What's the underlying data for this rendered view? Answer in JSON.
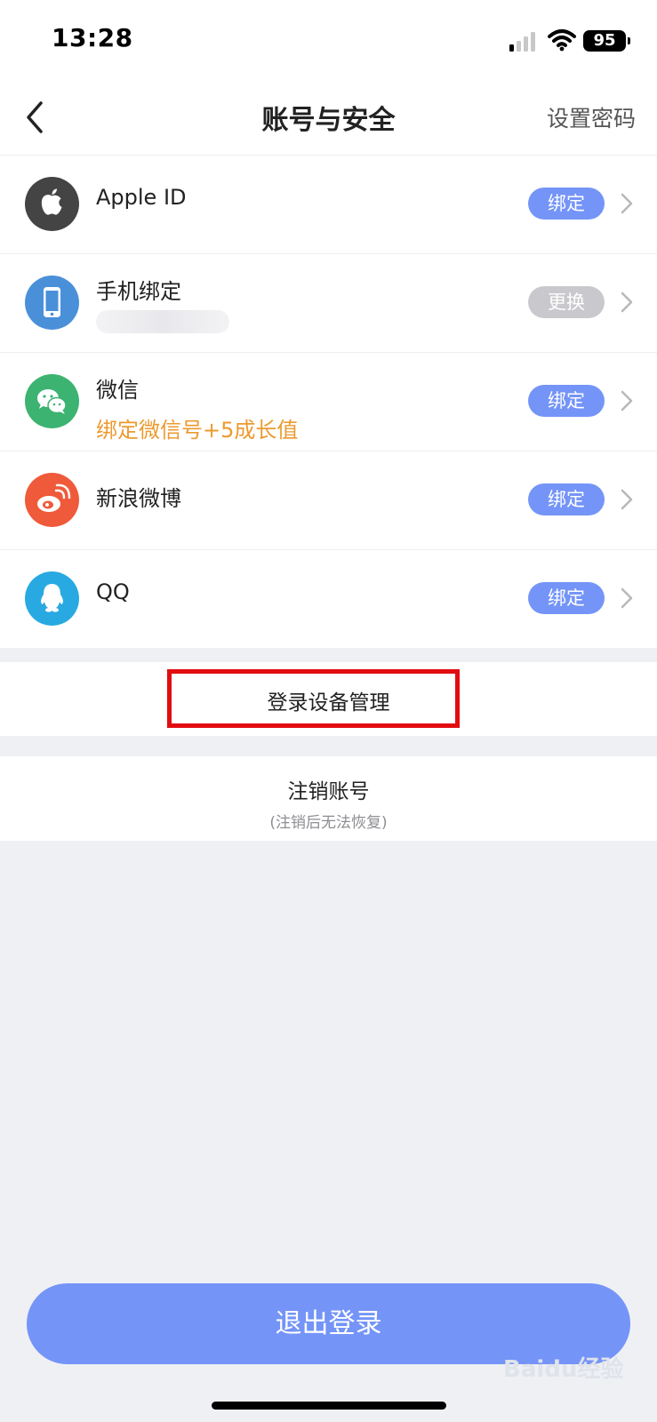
{
  "status_bar": {
    "time": "13:28",
    "battery": "95"
  },
  "header": {
    "title": "账号与安全",
    "right_action": "设置密码"
  },
  "accounts": [
    {
      "name": "Apple ID",
      "action": "绑定",
      "icon": "apple-icon",
      "icon_color": "#444444",
      "action_color": "#7494f7"
    },
    {
      "name": "手机绑定",
      "subtitle_hidden": true,
      "action": "更换",
      "icon": "phone-icon",
      "icon_color": "#4a90d9",
      "action_color": "#c9c9cd"
    },
    {
      "name": "微信",
      "subtitle": "绑定微信号+5成长值",
      "action": "绑定",
      "icon": "wechat-icon",
      "icon_color": "#3cb371",
      "action_color": "#7494f7"
    },
    {
      "name": "新浪微博",
      "action": "绑定",
      "icon": "weibo-icon",
      "icon_color": "#ef5a3a",
      "action_color": "#7494f7"
    },
    {
      "name": "QQ",
      "action": "绑定",
      "icon": "qq-icon",
      "icon_color": "#29a9e1",
      "action_color": "#7494f7"
    }
  ],
  "device_management": {
    "label": "登录设备管理"
  },
  "delete_account": {
    "label": "注销账号",
    "note": "(注销后无法恢复)"
  },
  "logout_button": {
    "label": "退出登录"
  },
  "watermark": {
    "text": "Baidu经验"
  }
}
